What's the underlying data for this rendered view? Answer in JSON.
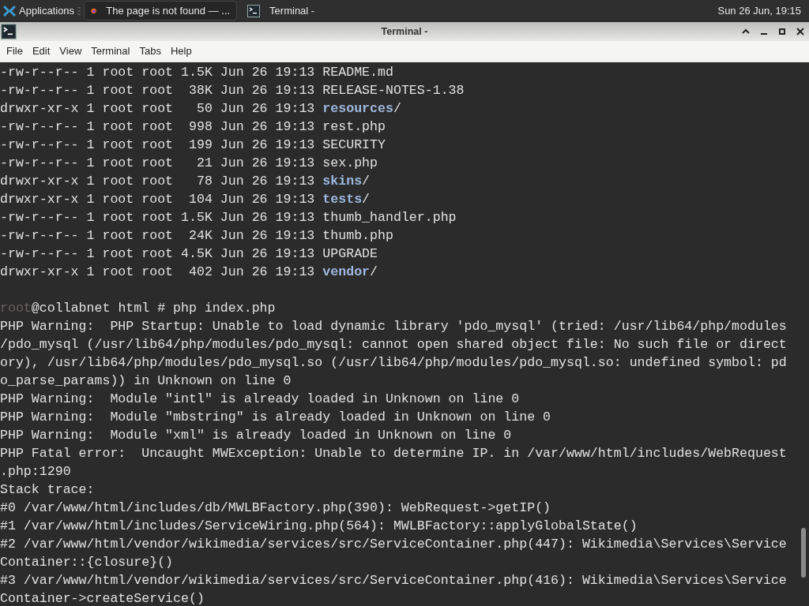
{
  "panel": {
    "applications": "Applications",
    "tasks": [
      {
        "label": "The page is not found — ...",
        "kind": "browser",
        "selected": true
      },
      {
        "label": "Terminal -",
        "kind": "terminal",
        "selected": false
      }
    ],
    "clock": "Sun 26 Jun, 19:15"
  },
  "window": {
    "title": "Terminal -"
  },
  "menu": [
    "File",
    "Edit",
    "View",
    "Terminal",
    "Tabs",
    "Help"
  ],
  "listing": [
    {
      "info": "-rw-r--r-- 1 root root 1.5K Jun 26 19:13",
      "name": "README.md",
      "directory": false
    },
    {
      "info": "-rw-r--r-- 1 root root  38K Jun 26 19:13",
      "name": "RELEASE-NOTES-1.38",
      "directory": false
    },
    {
      "info": "drwxr-xr-x 1 root root   50 Jun 26 19:13",
      "name": "resources",
      "suffix": "/",
      "directory": true
    },
    {
      "info": "-rw-r--r-- 1 root root  998 Jun 26 19:13",
      "name": "rest.php",
      "directory": false
    },
    {
      "info": "-rw-r--r-- 1 root root  199 Jun 26 19:13",
      "name": "SECURITY",
      "directory": false
    },
    {
      "info": "-rw-r--r-- 1 root root   21 Jun 26 19:13",
      "name": "sex.php",
      "directory": false
    },
    {
      "info": "drwxr-xr-x 1 root root   78 Jun 26 19:13",
      "name": "skins",
      "suffix": "/",
      "directory": true
    },
    {
      "info": "drwxr-xr-x 1 root root  104 Jun 26 19:13",
      "name": "tests",
      "suffix": "/",
      "directory": true
    },
    {
      "info": "-rw-r--r-- 1 root root 1.5K Jun 26 19:13",
      "name": "thumb_handler.php",
      "directory": false
    },
    {
      "info": "-rw-r--r-- 1 root root  24K Jun 26 19:13",
      "name": "thumb.php",
      "directory": false
    },
    {
      "info": "-rw-r--r-- 1 root root 4.5K Jun 26 19:13",
      "name": "UPGRADE",
      "directory": false
    },
    {
      "info": "drwxr-xr-x 1 root root  402 Jun 26 19:13",
      "name": "vendor",
      "suffix": "/",
      "directory": true
    }
  ],
  "prompt": {
    "user": "root",
    "rest": "@collabnet html # php index.php"
  },
  "output": [
    "PHP Warning:  PHP Startup: Unable to load dynamic library 'pdo_mysql' (tried: /usr/lib64/php/modules",
    "/pdo_mysql (/usr/lib64/php/modules/pdo_mysql: cannot open shared object file: No such file or direct",
    "ory), /usr/lib64/php/modules/pdo_mysql.so (/usr/lib64/php/modules/pdo_mysql.so: undefined symbol: pd",
    "o_parse_params)) in Unknown on line 0",
    "PHP Warning:  Module \"intl\" is already loaded in Unknown on line 0",
    "PHP Warning:  Module \"mbstring\" is already loaded in Unknown on line 0",
    "PHP Warning:  Module \"xml\" is already loaded in Unknown on line 0",
    "PHP Fatal error:  Uncaught MWException: Unable to determine IP. in /var/www/html/includes/WebRequest",
    ".php:1290",
    "Stack trace:",
    "#0 /var/www/html/includes/db/MWLBFactory.php(390): WebRequest->getIP()",
    "#1 /var/www/html/includes/ServiceWiring.php(564): MWLBFactory::applyGlobalState()",
    "#2 /var/www/html/vendor/wikimedia/services/src/ServiceContainer.php(447): Wikimedia\\Services\\Service",
    "Container::{closure}()",
    "#3 /var/www/html/vendor/wikimedia/services/src/ServiceContainer.php(416): Wikimedia\\Services\\Service",
    "Container->createService()"
  ]
}
